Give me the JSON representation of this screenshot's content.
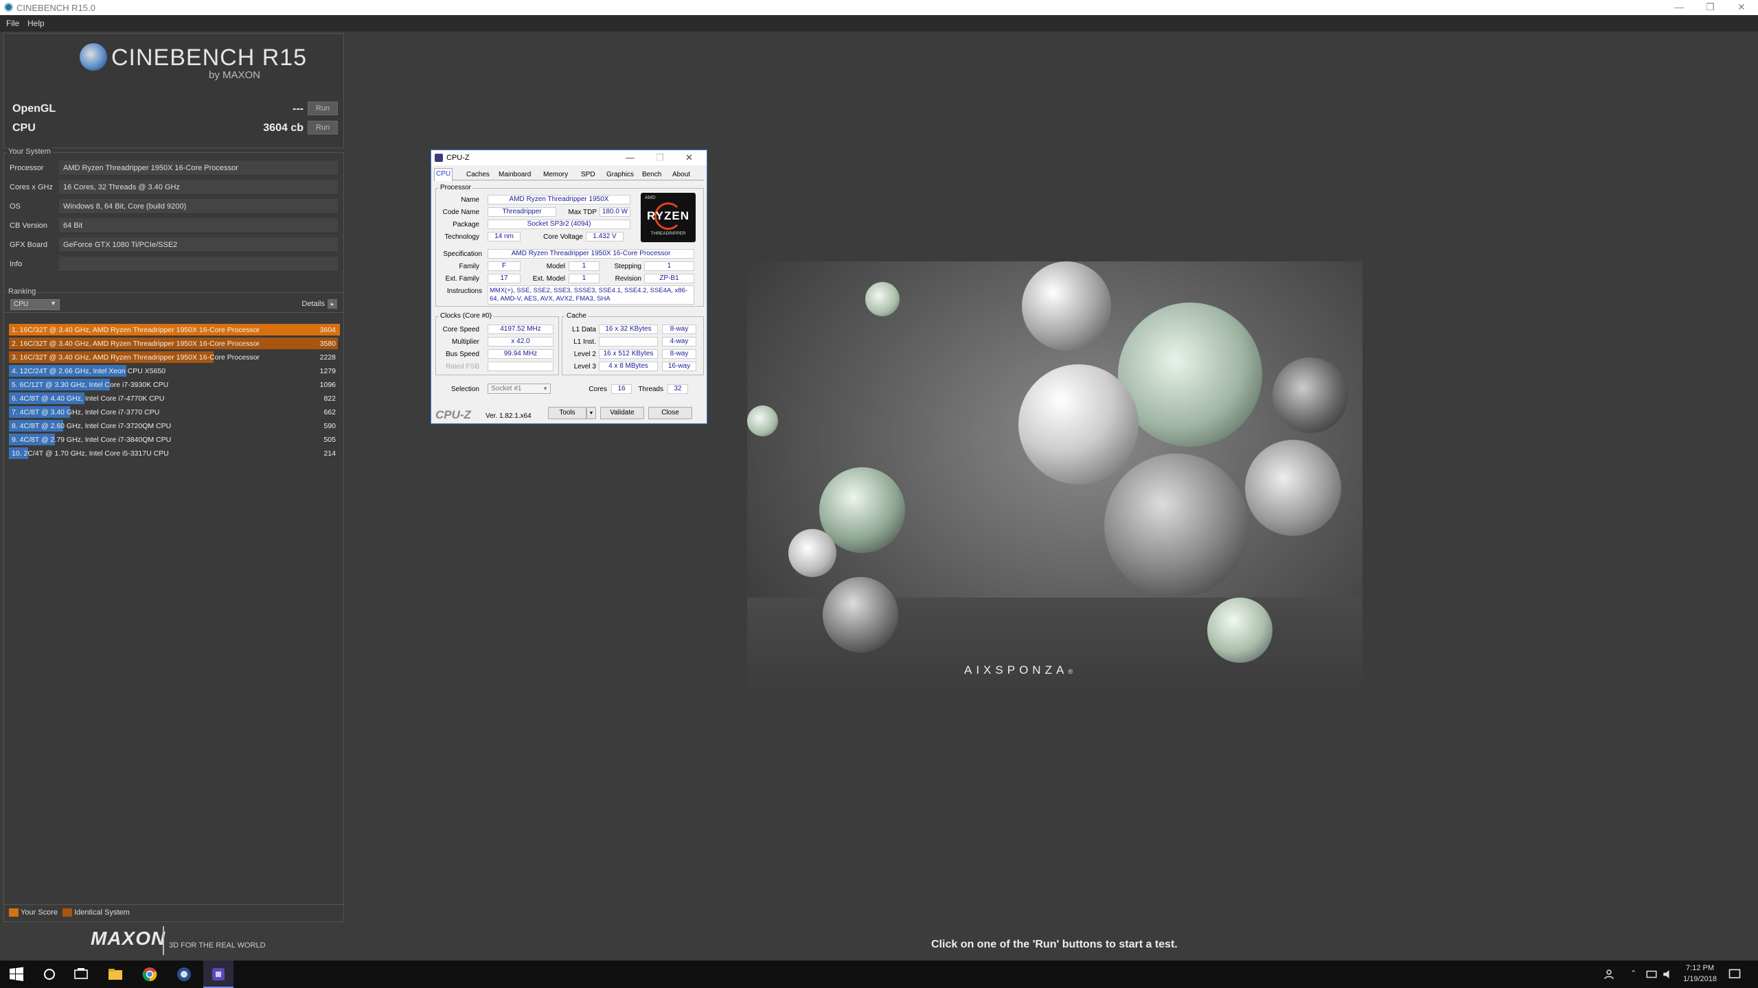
{
  "window": {
    "title": "CINEBENCH R15.0",
    "minimize": "—",
    "restore": "❐",
    "close": "✕"
  },
  "menu": [
    "File",
    "Help"
  ],
  "logo": {
    "title": "CINEBENCH R15",
    "by": "by MAXON"
  },
  "bench": {
    "opengl": {
      "label": "OpenGL",
      "value": "---",
      "run": "Run"
    },
    "cpu": {
      "label": "CPU",
      "value": "3604 cb",
      "run": "Run"
    }
  },
  "your_system": {
    "title": "Your System",
    "rows": [
      {
        "k": "Processor",
        "v": "AMD Ryzen Threadripper 1950X 16-Core Processor"
      },
      {
        "k": "Cores x GHz",
        "v": "16 Cores, 32 Threads @ 3.40 GHz"
      },
      {
        "k": "OS",
        "v": "Windows 8, 64 Bit, Core (build 9200)"
      },
      {
        "k": "CB Version",
        "v": "64 Bit"
      },
      {
        "k": "GFX Board",
        "v": "GeForce GTX 1080 Ti/PCIe/SSE2"
      },
      {
        "k": "Info",
        "v": ""
      }
    ]
  },
  "ranking": {
    "title": "Ranking",
    "dropdown": "CPU",
    "details": "Details",
    "rows": [
      {
        "text": "1. 16C/32T @ 3.40 GHz, AMD Ryzen Threadripper 1950X 16-Core Processor",
        "score": "3604",
        "fraction": 1.0,
        "kind": "your"
      },
      {
        "text": "2. 16C/32T @ 3.40 GHz, AMD Ryzen Threadripper 1950X 16-Core Processor",
        "score": "3580",
        "fraction": 0.993,
        "kind": "identical"
      },
      {
        "text": "3. 16C/32T @ 3.40 GHz, AMD Ryzen Threadripper 1950X 16-Core Processor",
        "score": "2228",
        "fraction": 0.618,
        "kind": "identical"
      },
      {
        "text": "4. 12C/24T @ 2.66 GHz, Intel Xeon CPU X5650",
        "score": "1279",
        "fraction": 0.355,
        "kind": "other"
      },
      {
        "text": "5. 6C/12T @ 3.30 GHz,  Intel Core i7-3930K CPU",
        "score": "1096",
        "fraction": 0.304,
        "kind": "other"
      },
      {
        "text": "6. 4C/8T @ 4.40 GHz, Intel Core i7-4770K CPU",
        "score": "822",
        "fraction": 0.228,
        "kind": "other"
      },
      {
        "text": "7. 4C/8T @ 3.40 GHz,  Intel Core i7-3770 CPU",
        "score": "662",
        "fraction": 0.184,
        "kind": "other"
      },
      {
        "text": "8. 4C/8T @ 2.60 GHz, Intel Core i7-3720QM CPU",
        "score": "590",
        "fraction": 0.164,
        "kind": "other"
      },
      {
        "text": "9. 4C/8T @ 2.79 GHz,  Intel Core i7-3840QM CPU",
        "score": "505",
        "fraction": 0.14,
        "kind": "other"
      },
      {
        "text": "10. 2C/4T @ 1.70 GHz,  Intel Core i5-3317U CPU",
        "score": "214",
        "fraction": 0.059,
        "kind": "other"
      }
    ],
    "legend": {
      "your": "Your Score",
      "identical": "Identical System"
    }
  },
  "colors": {
    "your": "#d9700f",
    "identical": "#a8560f",
    "other": "#3a72b8"
  },
  "footer": {
    "brand": "MAXON",
    "tagline": "3D FOR THE REAL WORLD",
    "status": "Click on one of the 'Run' buttons to start a test."
  },
  "render": {
    "brand": "AIXSPONZA",
    "mark": "®"
  },
  "cpuz": {
    "title": "CPU-Z",
    "tabs": [
      "CPU",
      "Caches",
      "Mainboard",
      "Memory",
      "SPD",
      "Graphics",
      "Bench",
      "About"
    ],
    "processor": {
      "group": "Processor",
      "name_label": "Name",
      "name": "AMD Ryzen Threadripper 1950X",
      "codename_label": "Code Name",
      "codename": "Threadripper",
      "tdp_label": "Max TDP",
      "tdp": "180.0 W",
      "package_label": "Package",
      "package": "Socket SP3r2 (4094)",
      "tech_label": "Technology",
      "tech": "14 nm",
      "voltage_label": "Core Voltage",
      "voltage": "1.432 V",
      "spec_label": "Specification",
      "spec": "AMD Ryzen Threadripper 1950X 16-Core Processor",
      "family_label": "Family",
      "family": "F",
      "model_label": "Model",
      "model": "1",
      "stepping_label": "Stepping",
      "stepping": "1",
      "extfamily_label": "Ext. Family",
      "extfamily": "17",
      "extmodel_label": "Ext. Model",
      "extmodel": "1",
      "revision_label": "Revision",
      "revision": "ZP-B1",
      "instr_label": "Instructions",
      "instr": "MMX(+), SSE, SSE2, SSE3, SSSE3, SSE4.1, SSE4.2, SSE4A, x86-64, AMD-V, AES, AVX, AVX2, FMA3, SHA"
    },
    "badge": {
      "top": "AMD",
      "name": "RYZEN",
      "sub": "THREADRIPPER"
    },
    "clocks": {
      "group": "Clocks (Core #0)",
      "speed_label": "Core Speed",
      "speed": "4197.52 MHz",
      "mult_label": "Multiplier",
      "mult": "x 42.0",
      "bus_label": "Bus Speed",
      "bus": "99.94 MHz",
      "fsb_label": "Rated FSB",
      "fsb": ""
    },
    "cache": {
      "group": "Cache",
      "rows": [
        {
          "k": "L1 Data",
          "v": "16 x 32 KBytes",
          "w": "8-way"
        },
        {
          "k": "L1 Inst.",
          "v": "",
          "w": "4-way"
        },
        {
          "k": "Level 2",
          "v": "16 x 512 KBytes",
          "w": "8-way"
        },
        {
          "k": "Level 3",
          "v": "4 x 8 MBytes",
          "w": "16-way"
        }
      ]
    },
    "selection_label": "Selection",
    "selection": "Socket #1",
    "cores_label": "Cores",
    "cores": "16",
    "threads_label": "Threads",
    "threads": "32",
    "logo": "CPU-Z",
    "version": "Ver. 1.82.1.x64",
    "tools": "Tools",
    "validate": "Validate",
    "close": "Close"
  },
  "taskbar": {
    "time": "7:12 PM",
    "date": "1/19/2018"
  }
}
